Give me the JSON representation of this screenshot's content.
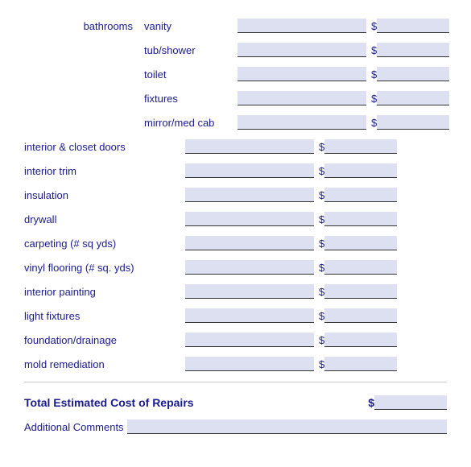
{
  "rows": [
    {
      "category": "bathrooms",
      "item": "vanity",
      "hasCategory": true
    },
    {
      "category": "",
      "item": "tub/shower",
      "hasCategory": false
    },
    {
      "category": "",
      "item": "toilet",
      "hasCategory": false
    },
    {
      "category": "",
      "item": "fixtures",
      "hasCategory": false
    },
    {
      "category": "",
      "item": "mirror/med cab",
      "hasCategory": false
    },
    {
      "category": "interior & closet doors",
      "item": "",
      "hasCategory": true,
      "noItem": true
    },
    {
      "category": "interior trim",
      "item": "",
      "hasCategory": true,
      "noItem": true
    },
    {
      "category": "insulation",
      "item": "",
      "hasCategory": true,
      "noItem": true
    },
    {
      "category": "drywall",
      "item": "",
      "hasCategory": true,
      "noItem": true
    },
    {
      "category": "carpeting (# sq yds)",
      "item": "",
      "hasCategory": true,
      "noItem": true
    },
    {
      "category": "vinyl flooring (# sq. yds)",
      "item": "",
      "hasCategory": true,
      "noItem": true
    },
    {
      "category": "interior painting",
      "item": "",
      "hasCategory": true,
      "noItem": true
    },
    {
      "category": "light fixtures",
      "item": "",
      "hasCategory": true,
      "noItem": true
    },
    {
      "category": "foundation/drainage",
      "item": "",
      "hasCategory": true,
      "noItem": true
    },
    {
      "category": "mold remediation",
      "item": "",
      "hasCategory": true,
      "noItem": true
    }
  ],
  "total_label": "Total Estimated Cost of Repairs",
  "additional_label": "Additional Comments",
  "dollar_sign": "$",
  "input_value": ""
}
